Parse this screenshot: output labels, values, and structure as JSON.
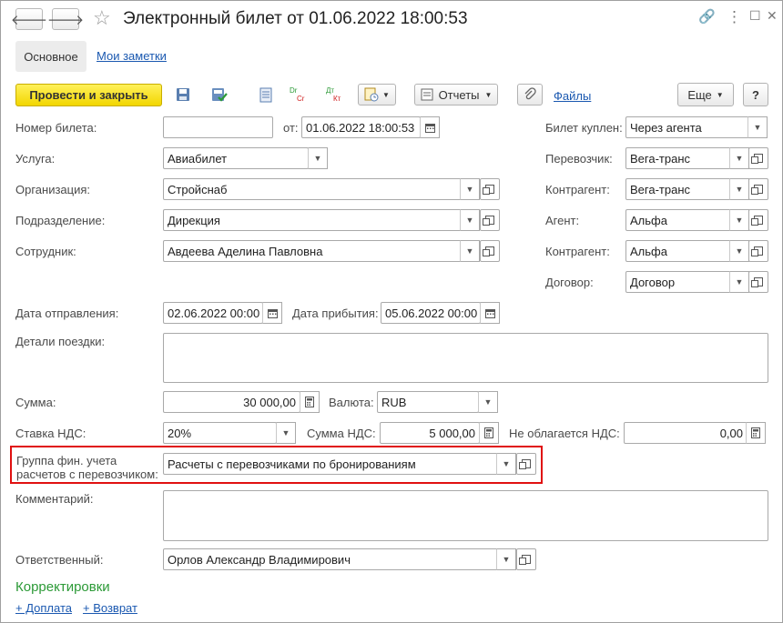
{
  "window": {
    "title": "Электронный билет  от 01.06.2022 18:00:53",
    "nav_back": "🡐",
    "nav_forward": "🡒",
    "star": "☆",
    "link_icon": "🔗",
    "more_icon": "⋮",
    "maximize_icon": "☐",
    "close_icon": "✕"
  },
  "tabs": {
    "main": "Основное",
    "notes": "Мои заметки"
  },
  "toolbar": {
    "post_close": "Провести и закрыть",
    "reports": "Отчеты",
    "files": "Файлы",
    "more": "Еще",
    "help": "?"
  },
  "form": {
    "ticket_number_label": "Номер билета:",
    "ticket_number": "",
    "from_label": "от:",
    "from_date": "01.06.2022 18:00:53",
    "service_label": "Услуга:",
    "service": "Авиабилет",
    "org_label": "Организация:",
    "org": "Стройснаб",
    "dept_label": "Подразделение:",
    "dept": "Дирекция",
    "employee_label": "Сотрудник:",
    "employee": "Авдеева Аделина Павловна",
    "bought_label": "Билет куплен:",
    "bought": "Через агента",
    "carrier_label": "Перевозчик:",
    "carrier": "Вега-транс",
    "counterparty1_label": "Контрагент:",
    "counterparty1": "Вега-транс",
    "agent_label": "Агент:",
    "agent": "Альфа",
    "counterparty2_label": "Контрагент:",
    "counterparty2": "Альфа",
    "contract_label": "Договор:",
    "contract": "Договор",
    "departure_label": "Дата отправления:",
    "departure": "02.06.2022 00:00",
    "arrival_label": "Дата прибытия:",
    "arrival": "05.06.2022 00:00",
    "trip_details_label": "Детали поездки:",
    "sum_label": "Сумма:",
    "sum": "30 000,00",
    "currency_label": "Валюта:",
    "currency": "RUB",
    "vat_rate_label": "Ставка НДС:",
    "vat_rate": "20%",
    "vat_sum_label": "Сумма НДС:",
    "vat_sum": "5 000,00",
    "no_vat_label": "Не облагается НДС:",
    "no_vat": "0,00",
    "fin_group_label_1": "Группа фин. учета",
    "fin_group_label_2": "расчетов с перевозчиком:",
    "fin_group": "Расчеты с перевозчиками по бронированиям",
    "comment_label": "Комментарий:",
    "responsible_label": "Ответственный:",
    "responsible": "Орлов Александр Владимирович"
  },
  "corrections": {
    "title": "Корректировки",
    "add_payment": "+ Доплата",
    "add_refund": "+ Возврат"
  }
}
